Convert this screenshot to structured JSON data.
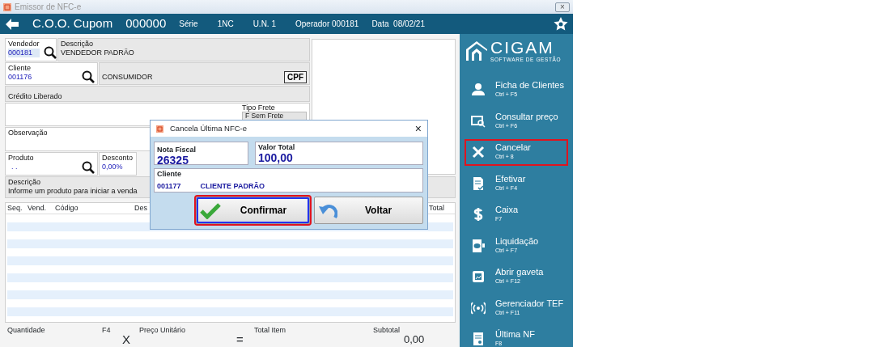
{
  "window": {
    "title": "Emissor de NFC-e",
    "close": "×"
  },
  "header": {
    "title": "C.O.O. Cupom",
    "coo": "000000",
    "serie_label": "Série",
    "serie": "1NC",
    "un": "U.N. 1",
    "operador": "Operador 000181",
    "data": "Data  08/02/21"
  },
  "form": {
    "vendedor": {
      "label": "Vendedor",
      "value": "000181"
    },
    "vendedor_descricao": {
      "label": "Descrição",
      "value": "VENDEDOR PADRÃO"
    },
    "cliente": {
      "label": "Cliente",
      "value": "001176"
    },
    "cliente_nome": "CONSUMIDOR",
    "cpf_button": "CPF",
    "credito": "Crédito Liberado",
    "tipo_frete": {
      "label": "Tipo Frete",
      "value": "F Sem Frete"
    },
    "observacao": "Observação",
    "produto": {
      "label": "Produto",
      "value": ". ."
    },
    "desconto": {
      "label": "Desconto",
      "value": "0,00%"
    },
    "descricao": {
      "label": "Descrição",
      "value": "Informe um produto para iniciar a venda"
    }
  },
  "table": {
    "columns": [
      "Seq.",
      "Vend.",
      "Código",
      "Des",
      "Total"
    ]
  },
  "totals": {
    "quantidade": "Quantidade",
    "f4": "F4",
    "times": "X",
    "preco": "Preço Unitário",
    "equals": "=",
    "total_item": "Total Item",
    "subtotal": "Subtotal",
    "subtotal_value": "0,00"
  },
  "sidebar": {
    "logo": "CIGAM",
    "tagline": "SOFTWARE DE GESTÃO",
    "items": [
      {
        "label": "Ficha de Clientes",
        "shortcut": "Ctrl + F5",
        "selected": false
      },
      {
        "label": "Consultar preço",
        "shortcut": "Ctrl + F6",
        "selected": false
      },
      {
        "label": "Cancelar",
        "shortcut": "Ctrl + 8",
        "selected": true
      },
      {
        "label": "Efetivar",
        "shortcut": "Ctrl + F4",
        "selected": false
      },
      {
        "label": "Caixa",
        "shortcut": "F7",
        "selected": false
      },
      {
        "label": "Liquidação",
        "shortcut": "Ctrl + F7",
        "selected": false
      },
      {
        "label": "Abrir gaveta",
        "shortcut": "Ctrl + F12",
        "selected": false
      },
      {
        "label": "Gerenciador TEF",
        "shortcut": "Ctrl + F11",
        "selected": false
      },
      {
        "label": "Última NF",
        "shortcut": "F8",
        "selected": false
      }
    ]
  },
  "dialog": {
    "title": "Cancela Última NFC-e",
    "close": "×",
    "nota_fiscal": {
      "label": "Nota Fiscal",
      "value": "26325"
    },
    "valor_total": {
      "label": "Valor Total",
      "value": "100,00"
    },
    "cliente": {
      "label": "Cliente",
      "code": "001177",
      "name": "CLIENTE PADRÃO"
    },
    "buttons": [
      {
        "label": "Confirmar",
        "focused": true
      },
      {
        "label": "Voltar",
        "focused": false
      }
    ]
  }
}
